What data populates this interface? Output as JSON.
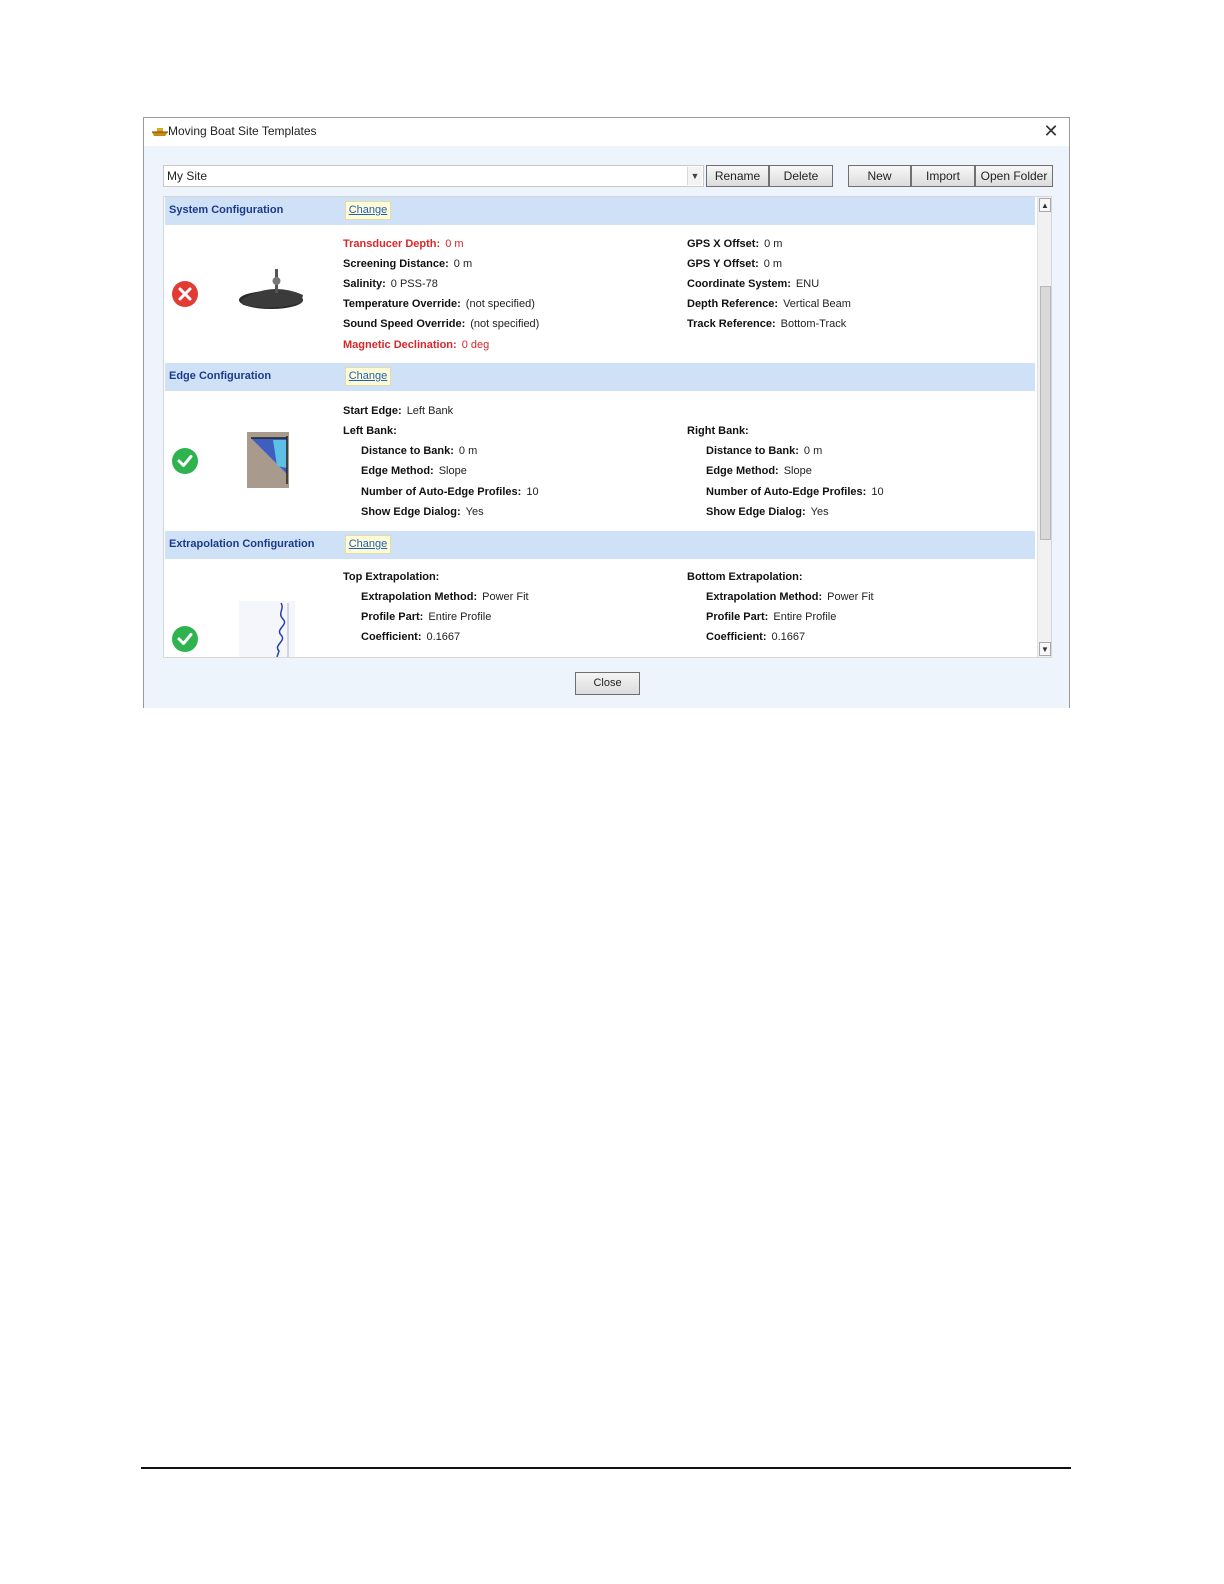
{
  "window": {
    "title": "Moving Boat Site Templates"
  },
  "site_selector": {
    "value": "My Site"
  },
  "toolbar": {
    "rename": "Rename",
    "delete": "Delete",
    "new": "New",
    "import": "Import",
    "open_folder": "Open Folder"
  },
  "sections": {
    "system": {
      "title": "System Configuration",
      "change": "Change",
      "status": "error",
      "left": [
        {
          "label": "Transducer Depth:",
          "value": "0 m",
          "highlight": true
        },
        {
          "label": "Screening Distance:",
          "value": "0 m"
        },
        {
          "label": "Salinity:",
          "value": "0 PSS-78"
        },
        {
          "label": "Temperature Override:",
          "value": "(not specified)"
        },
        {
          "label": "Sound Speed Override:",
          "value": "(not specified)"
        },
        {
          "label": "Magnetic Declination:",
          "value": "0 deg",
          "highlight": true
        }
      ],
      "right": [
        {
          "label": "GPS X Offset:",
          "value": "0 m"
        },
        {
          "label": "GPS Y Offset:",
          "value": "0 m"
        },
        {
          "label": "Coordinate System:",
          "value": "ENU"
        },
        {
          "label": "Depth Reference:",
          "value": "Vertical Beam"
        },
        {
          "label": "Track Reference:",
          "value": "Bottom-Track"
        }
      ]
    },
    "edge": {
      "title": "Edge Configuration",
      "change": "Change",
      "status": "ok",
      "start_edge": {
        "label": "Start Edge:",
        "value": "Left Bank"
      },
      "left_bank": {
        "heading": "Left Bank:",
        "items": [
          {
            "label": "Distance to Bank:",
            "value": "0 m"
          },
          {
            "label": "Edge Method:",
            "value": "Slope"
          },
          {
            "label": "Number of Auto-Edge Profiles:",
            "value": "10"
          },
          {
            "label": "Show Edge Dialog:",
            "value": "Yes"
          }
        ]
      },
      "right_bank": {
        "heading": "Right Bank:",
        "items": [
          {
            "label": "Distance to Bank:",
            "value": "0 m"
          },
          {
            "label": "Edge Method:",
            "value": "Slope"
          },
          {
            "label": "Number of Auto-Edge Profiles:",
            "value": "10"
          },
          {
            "label": "Show Edge Dialog:",
            "value": "Yes"
          }
        ]
      }
    },
    "extrapolation": {
      "title": "Extrapolation Configuration",
      "change": "Change",
      "status": "ok",
      "top": {
        "heading": "Top Extrapolation:",
        "items": [
          {
            "label": "Extrapolation Method:",
            "value": "Power Fit"
          },
          {
            "label": "Profile Part:",
            "value": "Entire Profile"
          },
          {
            "label": "Coefficient:",
            "value": "0.1667"
          }
        ]
      },
      "bottom": {
        "heading": "Bottom Extrapolation:",
        "items": [
          {
            "label": "Extrapolation Method:",
            "value": "Power Fit"
          },
          {
            "label": "Profile Part:",
            "value": "Entire Profile"
          },
          {
            "label": "Coefficient:",
            "value": "0.1667"
          }
        ]
      }
    }
  },
  "footer": {
    "close": "Close"
  },
  "colors": {
    "section_header": "#cfe1f7",
    "section_title": "#1c3a8a",
    "error": "#e23b33",
    "ok": "#2fb34f",
    "highlight": "#d9262a"
  },
  "icons": {
    "title": "boat-icon",
    "system_status": "error-x-circle-icon",
    "edge_status": "check-circle-icon",
    "extrapolation_status": "check-circle-icon"
  }
}
